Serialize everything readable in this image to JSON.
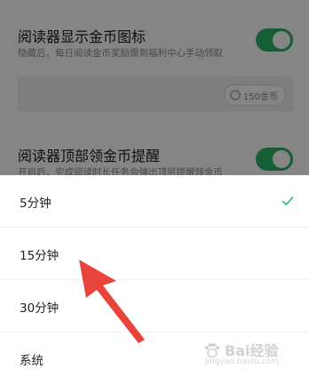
{
  "settings": {
    "coin_icon_title": "阅读器显示金币图标",
    "coin_icon_desc": "隐藏后，每日阅读金币奖励需到福利中心手动领取",
    "coin_icon_enabled": true,
    "preview_coin_amount": "150金币",
    "top_reminder_title": "阅读器顶部领金币提醒",
    "top_reminder_desc": "开启后，完成阅读时长任务会弹出顶层提醒领金币",
    "top_reminder_enabled": true
  },
  "sheet": {
    "options": [
      {
        "label": "5分钟",
        "selected": true
      },
      {
        "label": "15分钟",
        "selected": false
      },
      {
        "label": "30分钟",
        "selected": false
      },
      {
        "label": "系统",
        "selected": false
      }
    ]
  },
  "watermark": {
    "brand": "Bai经验",
    "url": "jingyan.baidu.com"
  },
  "colors": {
    "accent": "#2ab569",
    "arrow": "#e8443a",
    "overlay": "rgba(0,0,0,0.48)"
  },
  "icons": {
    "selected": "check-icon",
    "arrow": "red-arrow-annotation",
    "watermark": "baidu-paw-icon"
  }
}
